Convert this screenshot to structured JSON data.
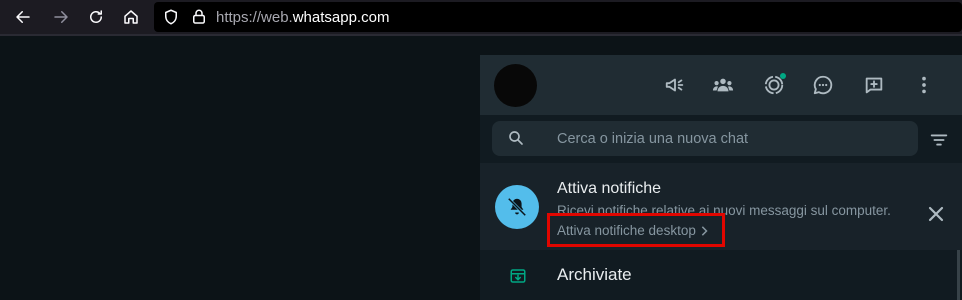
{
  "browser": {
    "url_prefix": "https://web.",
    "url_domain": "whatsapp.com",
    "icons": [
      "back-arrow-icon",
      "forward-arrow-icon",
      "reload-icon",
      "home-icon",
      "shield-icon",
      "lock-icon"
    ]
  },
  "header": {
    "icons": [
      "communities-megaphone-icon",
      "community-icon",
      "status-icon",
      "channels-icon",
      "new-chat-icon",
      "menu-icon"
    ]
  },
  "search": {
    "placeholder": "Cerca o inizia una nuova chat"
  },
  "notification": {
    "title": "Attiva notifiche",
    "description": "Ricevi notifiche relative ai nuovi messaggi sul computer.",
    "link_label": "Attiva notifiche desktop"
  },
  "archived": {
    "label": "Archiviate"
  },
  "colors": {
    "accent": "#00a884",
    "bell_bg": "#53bdeb",
    "highlight": "#e10600",
    "panel_bg": "#111b21",
    "header_bg": "#202c33"
  }
}
